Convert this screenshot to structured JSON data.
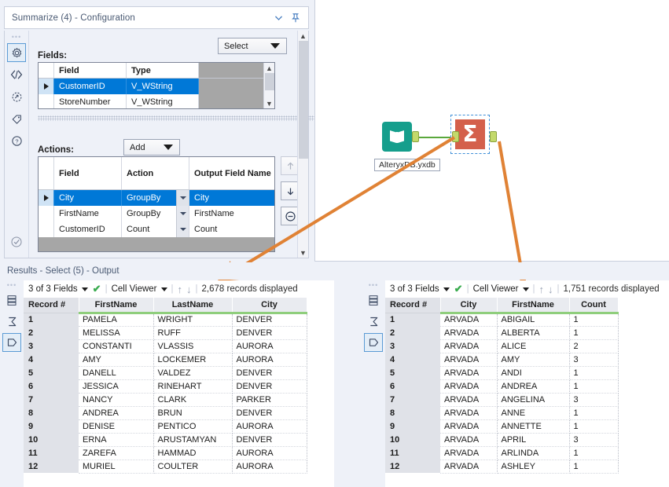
{
  "config": {
    "title": "Summarize (4) - Configuration",
    "collapse_icon": "chevron-down-icon",
    "pin_icon": "pin-icon",
    "rail": [
      {
        "name": "gear-icon",
        "glyph": "gear"
      },
      {
        "name": "code-icon",
        "glyph": "code"
      },
      {
        "name": "annotation-icon",
        "glyph": "annotation"
      },
      {
        "name": "tag-icon",
        "glyph": "tag"
      },
      {
        "name": "help-icon",
        "glyph": "help"
      }
    ],
    "rail_bottom": {
      "name": "check-circle-icon",
      "glyph": "check"
    },
    "fields_label": "Fields:",
    "select_dropdown": "Select",
    "fields_table": {
      "columns": [
        "Field",
        "Type"
      ],
      "rows": [
        {
          "field": "CustomerID",
          "type": "V_WString",
          "selected": true
        },
        {
          "field": "StoreNumber",
          "type": "V_WString",
          "selected": false
        }
      ]
    },
    "actions_label": "Actions:",
    "add_dropdown": "Add",
    "actions_table": {
      "columns": [
        "Field",
        "Action",
        "Output Field Name"
      ],
      "rows": [
        {
          "field": "City",
          "action": "GroupBy",
          "output": "City",
          "selected": true
        },
        {
          "field": "FirstName",
          "action": "GroupBy",
          "output": "FirstName",
          "selected": false
        },
        {
          "field": "CustomerID",
          "action": "Count",
          "output": "Count",
          "selected": false
        }
      ]
    },
    "side_buttons": [
      {
        "name": "move-up-button",
        "glyph": "↑",
        "disabled": true
      },
      {
        "name": "move-down-button",
        "glyph": "↓",
        "disabled": false
      },
      {
        "name": "remove-action-button",
        "glyph": "⊖",
        "disabled": false
      }
    ]
  },
  "canvas": {
    "input_node": {
      "name": "input-data-node",
      "label": "AlteryxDB.yxdb",
      "icon": "book-icon",
      "color": "#159e8c"
    },
    "summarize_node": {
      "name": "summarize-node",
      "icon": "sigma-icon",
      "glyph": "Σ",
      "color": "#d4604b",
      "selected": true
    },
    "connection_color": "#5aa83c",
    "annotation_color": "#e08235"
  },
  "results": {
    "title": "Results - Select (5) - Output",
    "rail": [
      {
        "name": "data-grid-icon",
        "glyph": "grid"
      },
      {
        "name": "sigma-icon",
        "glyph": "sigma"
      },
      {
        "name": "output-anchor-icon",
        "glyph": "output",
        "active": true
      }
    ],
    "left": {
      "fields_label": "3 of 3 Fields",
      "viewer_label": "Cell Viewer",
      "record_count": "2,678 records displayed",
      "columns": [
        "Record #",
        "FirstName",
        "LastName",
        "City"
      ],
      "rows": [
        [
          "1",
          "PAMELA",
          "WRIGHT",
          "DENVER"
        ],
        [
          "2",
          "MELISSA",
          "RUFF",
          "DENVER"
        ],
        [
          "3",
          "CONSTANTI",
          "VLASSIS",
          "AURORA"
        ],
        [
          "4",
          "AMY",
          "LOCKEMER",
          "AURORA"
        ],
        [
          "5",
          "DANELL",
          "VALDEZ",
          "DENVER"
        ],
        [
          "6",
          "JESSICA",
          "RINEHART",
          "DENVER"
        ],
        [
          "7",
          "NANCY",
          "CLARK",
          "PARKER"
        ],
        [
          "8",
          "ANDREA",
          "BRUN",
          "DENVER"
        ],
        [
          "9",
          "DENISE",
          "PENTICO",
          "AURORA"
        ],
        [
          "10",
          "ERNA",
          "ARUSTAMYAN",
          "DENVER"
        ],
        [
          "11",
          "ZAREFA",
          "HAMMAD",
          "AURORA"
        ],
        [
          "12",
          "MURIEL",
          "COULTER",
          "AURORA"
        ]
      ]
    },
    "right": {
      "fields_label": "3 of 3 Fields",
      "viewer_label": "Cell Viewer",
      "record_count": "1,751 records displayed",
      "columns": [
        "Record #",
        "City",
        "FirstName",
        "Count"
      ],
      "rows": [
        [
          "1",
          "ARVADA",
          "ABIGAIL",
          "1"
        ],
        [
          "2",
          "ARVADA",
          "ALBERTA",
          "1"
        ],
        [
          "3",
          "ARVADA",
          "ALICE",
          "2"
        ],
        [
          "4",
          "ARVADA",
          "AMY",
          "3"
        ],
        [
          "5",
          "ARVADA",
          "ANDI",
          "1"
        ],
        [
          "6",
          "ARVADA",
          "ANDREA",
          "1"
        ],
        [
          "7",
          "ARVADA",
          "ANGELINA",
          "3"
        ],
        [
          "8",
          "ARVADA",
          "ANNE",
          "1"
        ],
        [
          "9",
          "ARVADA",
          "ANNETTE",
          "1"
        ],
        [
          "10",
          "ARVADA",
          "APRIL",
          "3"
        ],
        [
          "11",
          "ARVADA",
          "ARLINDA",
          "1"
        ],
        [
          "12",
          "ARVADA",
          "ASHLEY",
          "1"
        ]
      ]
    }
  }
}
